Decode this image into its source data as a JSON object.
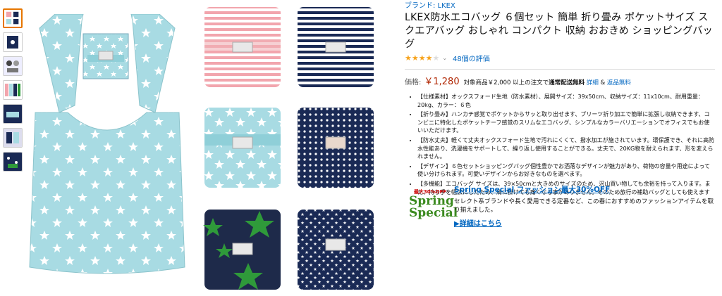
{
  "brand": "ブランド: LKEX",
  "title": "LKEX防水エコバッグ ６個セット 簡単 折り畳み ポケットサイズ スクエアバッグ おしゃれ コンパクト 収納 おおきめ ショッピングバッグ",
  "rating": {
    "stars_filled": 4,
    "stars_total": 5,
    "caret": "⌄",
    "reviews": "48個の評価"
  },
  "price": {
    "label": "価格:",
    "value": "￥1,280",
    "note_prefix": "対象商品￥2,000 以上の注文で",
    "note_bold": "通常配送無料",
    "note_link1": "詳細",
    "note_mid": " & ",
    "note_link2": "返品無料"
  },
  "bullets": [
    "【仕様素材】オックスフォード生地（防水素材）、展開サイズ：39x50cm、収納サイズ：11x10cm、耐用重量：20kg、カラー：６色",
    "【折り畳み】ハンカチ感覚でポケットからサッと取り出せます、プリーツ折り加工で簡単に拡張し収納できます、コンビニに特化したポケットチーフ感覚のスリムなエコバッグ、シンプルなカラーバリエーションでオフィスでもお使いいただけます。",
    "【防水丈夫】軽くて丈夫オックスフォード生地で汚れにくくて、撥水加工が施されています。環保護でき、それに高防水性能あり、洗濯機をサポートして、繰り返し使用することができる。丈夫で、20KG物を耐えられます、形を変えられません。",
    "【デザイン】６色セットショッピングバッグ個性豊かでお洒落なデザインが魅力があり、荷物の容量や用途によって使い分けられます。可愛いデザインからお好きなものを選べます。",
    "【多機能】エコバッグ サイズは、39×50cmと大きめのサイズのため、沢山買い物しても余裕を持って入ります。また、持ち手を幅広にしたため、肩に掛けても痛くなる事がありません。そのため旅行の補助バッグとしても使えます"
  ],
  "promo": {
    "tag": "最大30%OFF",
    "logo_line1": "Spring",
    "logo_line2": "Special",
    "title": "Spring Special ファッション最大30%OFF",
    "desc": "セレクト系ブランドや長く愛用できる定番など、この春におすすめのファッションアイテムを取り揃えました。",
    "link": "▶詳細はこちら"
  },
  "colors": {
    "mint": "#a8dbe3",
    "navy": "#1a2a55",
    "pink": "#f2a5ad",
    "green_star": "#2f9a3a",
    "link": "#0066c0",
    "price": "#b12704",
    "star": "#f7a31c"
  }
}
